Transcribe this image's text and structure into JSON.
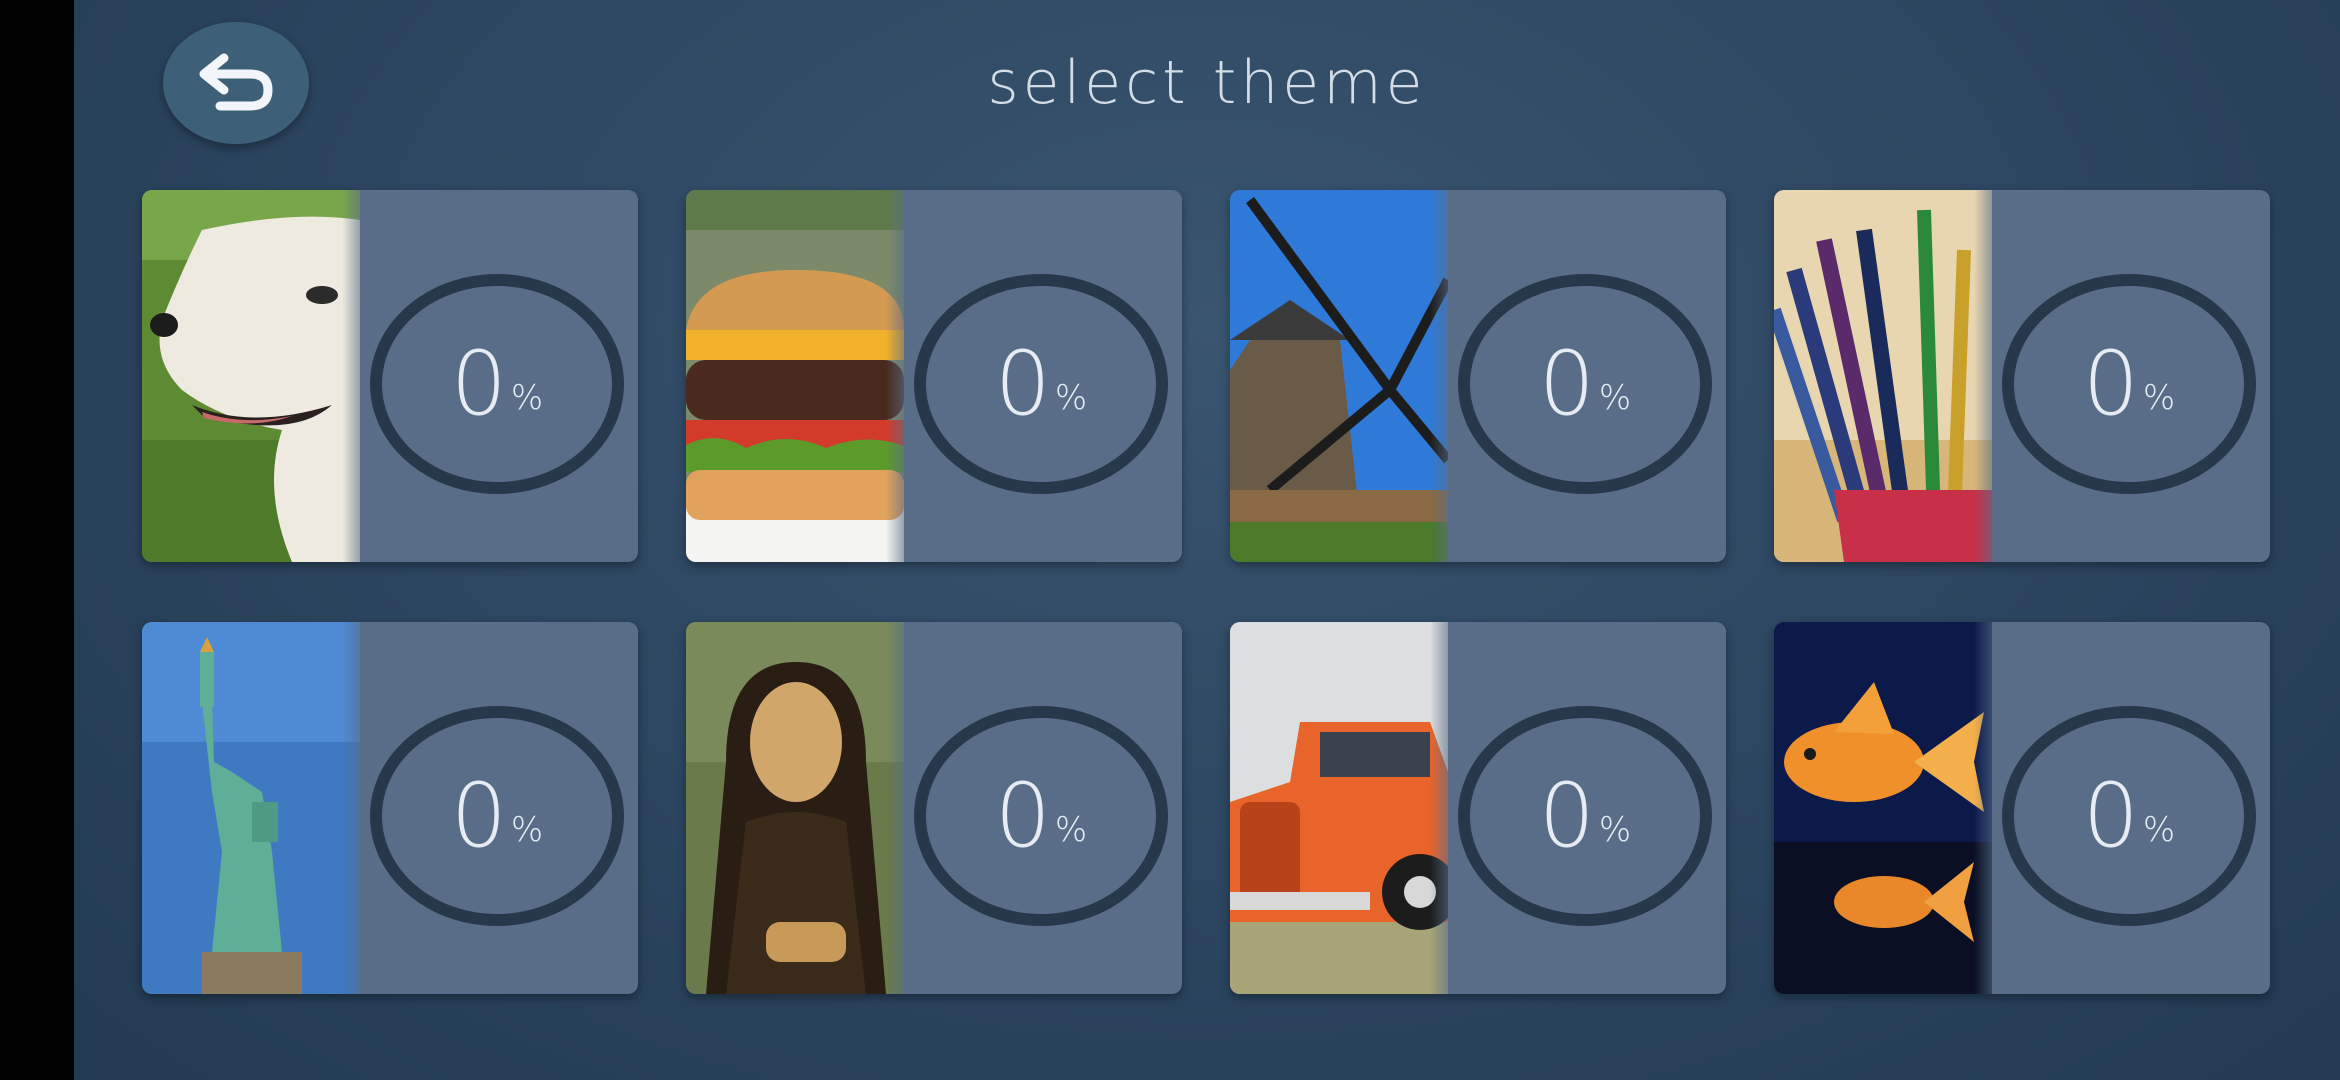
{
  "header": {
    "title": "select theme",
    "back_icon": "back-arrow-icon"
  },
  "themes": [
    {
      "subject": "dog",
      "progress": "0",
      "percent_sign": "%"
    },
    {
      "subject": "burger",
      "progress": "0",
      "percent_sign": "%"
    },
    {
      "subject": "windmill",
      "progress": "0",
      "percent_sign": "%"
    },
    {
      "subject": "pencils",
      "progress": "0",
      "percent_sign": "%"
    },
    {
      "subject": "statue-of-liberty",
      "progress": "0",
      "percent_sign": "%"
    },
    {
      "subject": "mona-lisa",
      "progress": "0",
      "percent_sign": "%"
    },
    {
      "subject": "vintage-car",
      "progress": "0",
      "percent_sign": "%"
    },
    {
      "subject": "goldfish",
      "progress": "0",
      "percent_sign": "%"
    }
  ],
  "colors": {
    "background": "#2c4560",
    "card": "#596d88",
    "ring": "#27384b",
    "button": "#3d6078"
  }
}
